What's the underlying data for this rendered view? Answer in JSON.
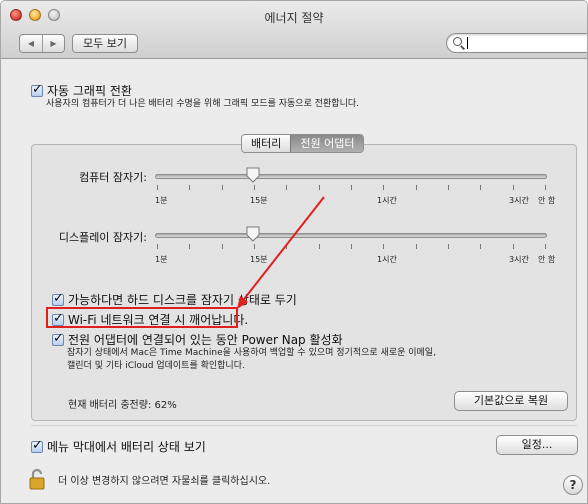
{
  "window": {
    "title": "에너지 절약"
  },
  "toolbar": {
    "back_icon": "back-arrow-icon",
    "forward_icon": "forward-arrow-icon",
    "show_all_label": "모두 보기",
    "search_value": "",
    "search_icon": "search-icon"
  },
  "auto_graphics": {
    "label": "자동 그래픽 전환",
    "checked": true,
    "description": "사용자의 컴퓨터가 더 나은 배터리 수명을 위해 그래픽 모드를 자동으로 전환합니다."
  },
  "tabs": [
    {
      "label": "배터리",
      "active": false
    },
    {
      "label": "전원 어댑터",
      "active": true
    }
  ],
  "sliders": {
    "computer_sleep": {
      "label": "컴퓨터 잠자기:",
      "value_fraction": 0.25
    },
    "display_sleep": {
      "label": "디스플레이 잠자기:",
      "value_fraction": 0.25
    },
    "tick_labels": [
      "1분",
      "15분",
      "1시간",
      "3시간",
      "안 함"
    ]
  },
  "options": {
    "hard_disk_sleep": {
      "label": "가능하다면 하드 디스크를 잠자기 상태로 두기",
      "checked": true
    },
    "wifi_wake": {
      "label": "Wi-Fi 네트워크 연결 시 깨어납니다.",
      "checked": true
    },
    "power_nap": {
      "label": "전원 어댑터에 연결되어 있는 동안 Power Nap 활성화",
      "checked": true,
      "description_line1": "잠자기 상태에서 Mac은 Time Machine을 사용하여 백업할 수 있으며 정기적으로 새로운 이메일,",
      "description_line2": "캘린더 및 기타 iCloud 업데이트를 확인합니다."
    }
  },
  "battery_status": "현재 배터리 충전량: 62%",
  "restore_defaults_label": "기본값으로 복원",
  "menu_bar_battery": {
    "label": "메뉴 막대에서 배터리 상태 보기",
    "checked": true
  },
  "schedule_label": "일정...",
  "lock_text": "더 이상 변경하지 않으려면 자물쇠를 클릭하십시오.",
  "help_label": "?",
  "colors": {
    "annotation_red": "#e0201e"
  }
}
